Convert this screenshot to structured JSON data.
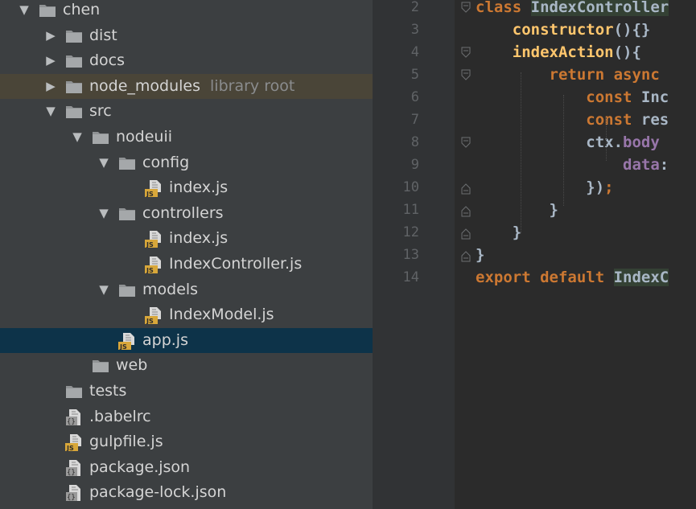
{
  "tree": {
    "rows": [
      {
        "label": "chen",
        "arrow": "▼",
        "type": "folder",
        "depth": 0
      },
      {
        "label": "dist",
        "arrow": "▶",
        "type": "folder",
        "depth": 1
      },
      {
        "label": "docs",
        "arrow": "▶",
        "type": "folder",
        "depth": 1
      },
      {
        "label": "node_modules",
        "extra": "library root",
        "arrow": "▶",
        "type": "folder",
        "depth": 1
      },
      {
        "label": "src",
        "arrow": "▼",
        "type": "folder",
        "depth": 1
      },
      {
        "label": "nodeuii",
        "arrow": "▼",
        "type": "folder",
        "depth": 2
      },
      {
        "label": "config",
        "arrow": "▼",
        "type": "folder",
        "depth": 3
      },
      {
        "label": "index.js",
        "arrow": "",
        "type": "js",
        "depth": 4
      },
      {
        "label": "controllers",
        "arrow": "▼",
        "type": "folder",
        "depth": 3
      },
      {
        "label": "index.js",
        "arrow": "",
        "type": "js",
        "depth": 4
      },
      {
        "label": "IndexController.js",
        "arrow": "",
        "type": "js",
        "depth": 4
      },
      {
        "label": "models",
        "arrow": "▼",
        "type": "folder",
        "depth": 3
      },
      {
        "label": "IndexModel.js",
        "arrow": "",
        "type": "js",
        "depth": 4
      },
      {
        "label": "app.js",
        "arrow": "",
        "type": "js",
        "depth": 3,
        "selected": true
      },
      {
        "label": "web",
        "arrow": "",
        "type": "folder",
        "depth": 2
      },
      {
        "label": "tests",
        "arrow": "",
        "type": "folder",
        "depth": 1
      },
      {
        "label": ".babelrc",
        "arrow": "",
        "type": "cfg",
        "depth": 1
      },
      {
        "label": "gulpfile.js",
        "arrow": "",
        "type": "js",
        "depth": 1
      },
      {
        "label": "package.json",
        "arrow": "",
        "type": "cfg",
        "depth": 1
      },
      {
        "label": "package-lock.json",
        "arrow": "",
        "type": "cfg",
        "depth": 1
      }
    ]
  },
  "editor": {
    "lines": [
      {
        "num": "2",
        "tokens": [
          {
            "t": "class ",
            "c": "kw"
          },
          {
            "t": "IndexController",
            "c": "cls"
          }
        ]
      },
      {
        "num": "3",
        "tokens": [
          {
            "t": "    constructor",
            "c": "fn"
          },
          {
            "t": "(){}",
            "c": "plain"
          }
        ]
      },
      {
        "num": "4",
        "tokens": [
          {
            "t": "    indexAction",
            "c": "fn"
          },
          {
            "t": "(){",
            "c": "plain"
          }
        ]
      },
      {
        "num": "5",
        "tokens": [
          {
            "t": "        return async",
            "c": "kw"
          }
        ]
      },
      {
        "num": "6",
        "tokens": [
          {
            "t": "            const ",
            "c": "kw"
          },
          {
            "t": "Inc",
            "c": "plain"
          }
        ]
      },
      {
        "num": "7",
        "tokens": [
          {
            "t": "            const ",
            "c": "kw"
          },
          {
            "t": "res",
            "c": "plain"
          }
        ]
      },
      {
        "num": "8",
        "tokens": [
          {
            "t": "            ctx.",
            "c": "plain"
          },
          {
            "t": "body",
            "c": "prop"
          }
        ]
      },
      {
        "num": "9",
        "tokens": [
          {
            "t": "                data",
            "c": "prop"
          },
          {
            "t": ":",
            "c": "plain"
          }
        ]
      },
      {
        "num": "10",
        "tokens": [
          {
            "t": "            })",
            "c": "plain"
          },
          {
            "t": ";",
            "c": "kw"
          }
        ]
      },
      {
        "num": "11",
        "tokens": [
          {
            "t": "        }",
            "c": "plain"
          }
        ]
      },
      {
        "num": "12",
        "tokens": [
          {
            "t": "    }",
            "c": "plain"
          }
        ]
      },
      {
        "num": "13",
        "tokens": [
          {
            "t": "}",
            "c": "plain"
          }
        ]
      },
      {
        "num": "14",
        "tokens": [
          {
            "t": "export default ",
            "c": "kw"
          },
          {
            "t": "IndexC",
            "c": "cls"
          }
        ]
      }
    ]
  }
}
